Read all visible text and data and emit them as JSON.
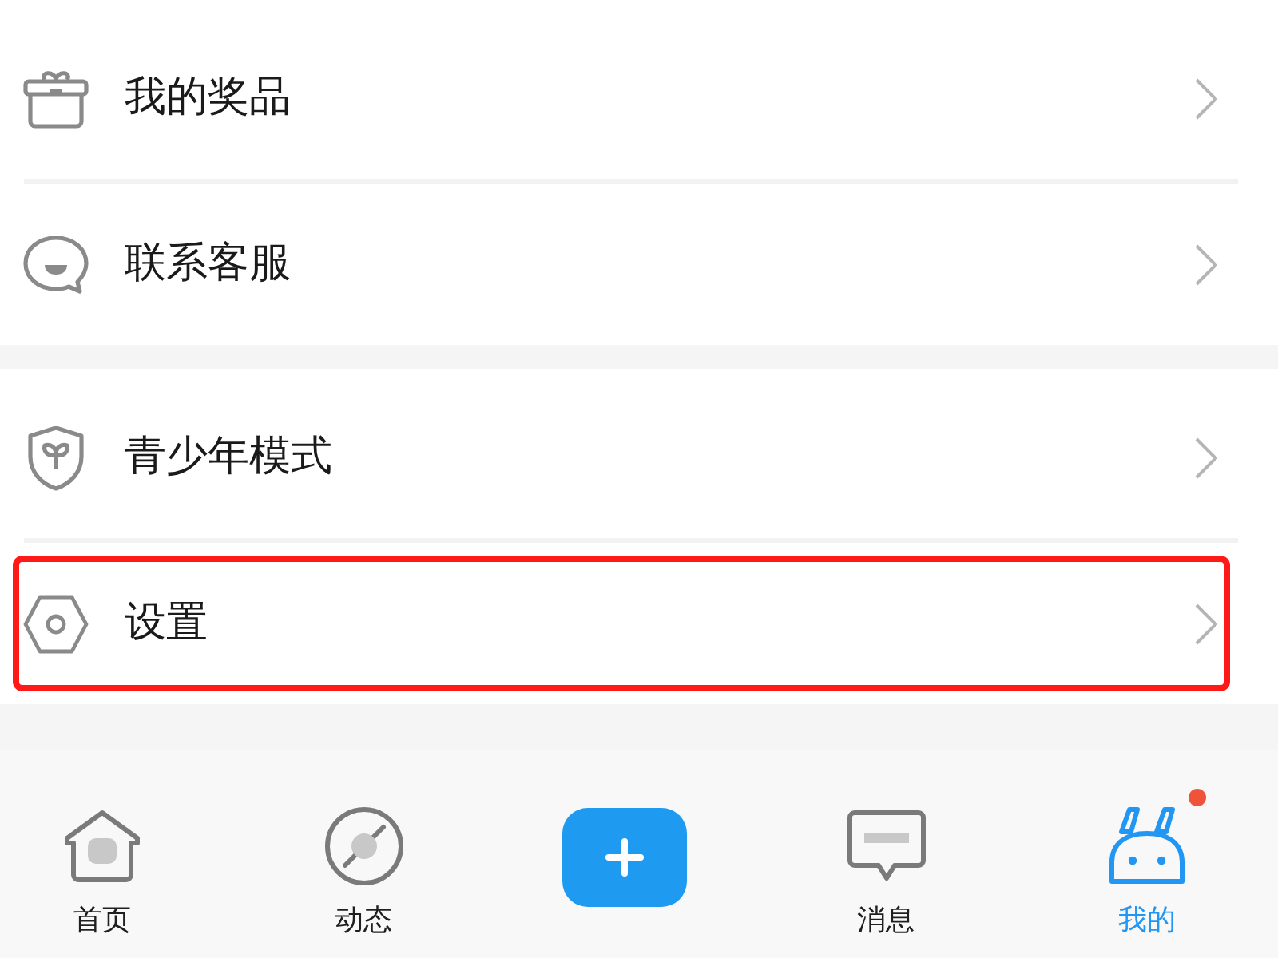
{
  "menu_groups": [
    {
      "items": [
        {
          "kind": "gift",
          "label": "我的奖品",
          "highlighted": false
        },
        {
          "kind": "support",
          "label": "联系客服",
          "highlighted": false
        }
      ]
    },
    {
      "items": [
        {
          "kind": "teen_mode",
          "label": "青少年模式",
          "highlighted": false
        },
        {
          "kind": "settings",
          "label": "设置",
          "highlighted": true
        }
      ]
    }
  ],
  "tab_bar": {
    "tabs": [
      {
        "kind": "home",
        "label": "首页",
        "selected": false,
        "badge": false
      },
      {
        "kind": "feed",
        "label": "动态",
        "selected": false,
        "badge": false
      },
      {
        "kind": "publish",
        "selected": false,
        "badge": false
      },
      {
        "kind": "messages",
        "label": "消息",
        "selected": false,
        "badge": false
      },
      {
        "kind": "profile",
        "label": "我的",
        "selected": true,
        "badge": true
      }
    ]
  }
}
